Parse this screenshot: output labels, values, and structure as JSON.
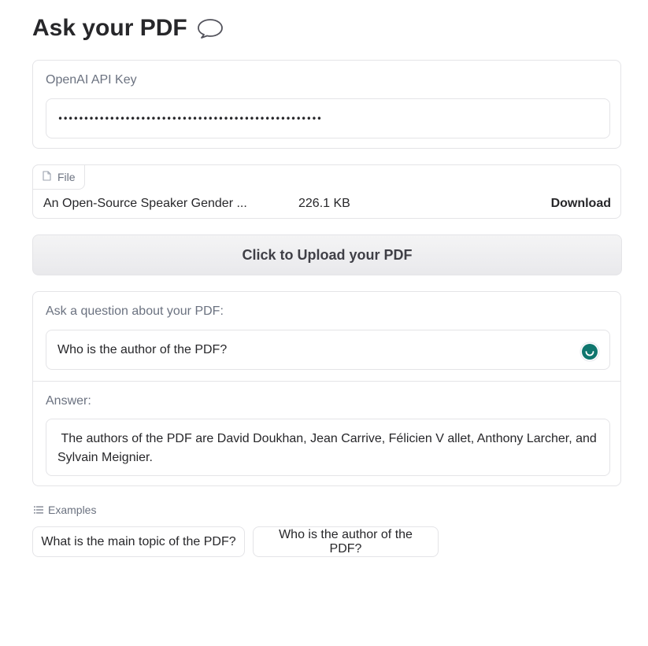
{
  "header": {
    "title": "Ask your PDF",
    "icon": "speech-bubble-icon"
  },
  "api_key": {
    "label": "OpenAI API Key",
    "value": "•••••••••••••••••••••••••••••••••••••••••••••••••••"
  },
  "file": {
    "tab_label": "File",
    "icon": "file-icon",
    "name": "An Open-Source Speaker Gender ...",
    "size": "226.1 KB",
    "download_label": "Download"
  },
  "upload": {
    "label": "Click to Upload your PDF"
  },
  "qa": {
    "question_label": "Ask a question about your PDF:",
    "question_value": "Who is the author of the PDF?",
    "answer_label": "Answer:",
    "answer_value": " The authors of the PDF are David Doukhan, Jean Carrive, Félicien V allet, Anthony Larcher, and Sylvain Meignier."
  },
  "examples": {
    "label": "Examples",
    "items": [
      {
        "label": "What is the main topic of the PDF?"
      },
      {
        "label": "Who is the author of the PDF?"
      }
    ]
  },
  "colors": {
    "accent_green": "#0f766e",
    "border": "#e4e4e7",
    "muted_text": "#6b7280"
  }
}
